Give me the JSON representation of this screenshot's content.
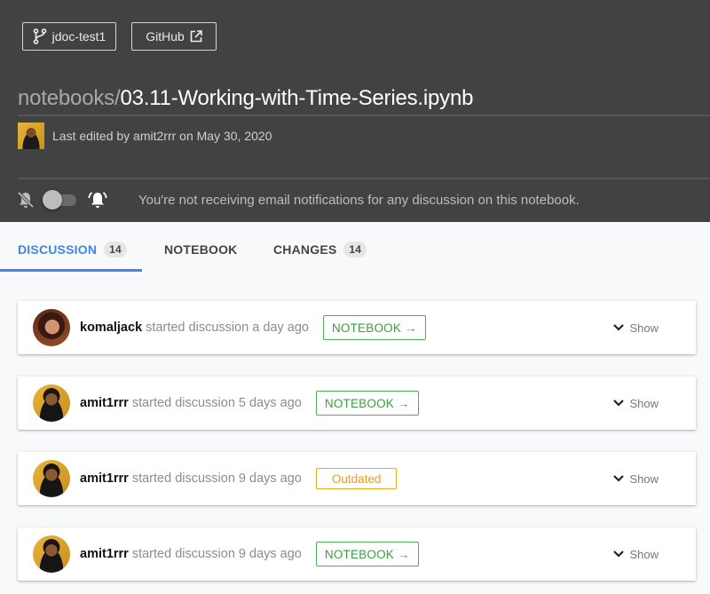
{
  "header": {
    "branch_button": {
      "label": "jdoc-test1",
      "icon": "git-branch-icon"
    },
    "github_button": {
      "label": "GitHub",
      "icon": "external-link-icon"
    },
    "breadcrumb_path": "notebooks/",
    "notebook_name": "03.11-Working-with-Time-Series.ipynb",
    "last_edited": "Last edited by amit2rrr on May 30, 2020",
    "notifications": {
      "enabled": false,
      "off_icon": "bell-off-icon",
      "on_icon": "bell-ring-icon",
      "message": "You're not receiving email notifications for any discussion on this notebook."
    }
  },
  "tabs": [
    {
      "label": "DISCUSSION",
      "count": "14",
      "active": true
    },
    {
      "label": "NOTEBOOK",
      "count": null,
      "active": false
    },
    {
      "label": "CHANGES",
      "count": "14",
      "active": false
    }
  ],
  "colors": {
    "header_bg": "#424242",
    "accent_blue": "#3e86e8",
    "notebook_green": "#4caf50",
    "outdated_orange": "#f5a623",
    "page_bg": "#f8f9fa"
  },
  "discussions": [
    {
      "user": "komaljack",
      "action": "started discussion a day ago",
      "badge": "NOTEBOOK →",
      "badge_type": "notebook",
      "toggle": "Show"
    },
    {
      "user": "amit1rrr",
      "action": "started discussion 5 days ago",
      "badge": "NOTEBOOK →",
      "badge_type": "notebook",
      "toggle": "Show"
    },
    {
      "user": "amit1rrr",
      "action": "started discussion 9 days ago",
      "badge": "Outdated",
      "badge_type": "outdated",
      "toggle": "Show"
    },
    {
      "user": "amit1rrr",
      "action": "started discussion 9 days ago",
      "badge": "NOTEBOOK →",
      "badge_type": "notebook",
      "toggle": "Show"
    }
  ]
}
